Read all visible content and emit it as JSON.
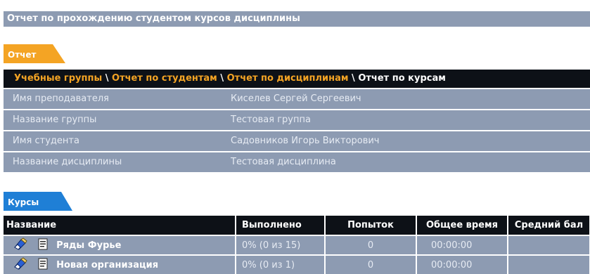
{
  "header": {
    "title": "Отчет по прохождению студентом курсов дисциплины"
  },
  "report_tab": {
    "label": "Отчет"
  },
  "nav": {
    "groups": "Учебные группы",
    "students": "Отчет по студентам",
    "disciplines": "Отчет по дисциплинам",
    "courses": "Отчет по курсам",
    "separator": "\\"
  },
  "info": [
    {
      "label": "Имя преподавателя",
      "value": "Киселев Сергей Сергеевич"
    },
    {
      "label": "Название группы",
      "value": "Тестовая группа"
    },
    {
      "label": "Имя студента",
      "value": "Садовников Игорь Викторович"
    },
    {
      "label": "Название дисциплины",
      "value": "Тестовая дисциплина"
    }
  ],
  "courses_tab": {
    "label": "Курсы"
  },
  "table": {
    "headers": {
      "name": "Название",
      "done": "Выполнено",
      "attempts": "Попыток",
      "time": "Общее время",
      "avg": "Средний бал"
    },
    "rows": [
      {
        "name": "Ряды Фурье",
        "done": "0% (0 из 15)",
        "attempts": "0",
        "time": "00:00:00",
        "avg": ""
      },
      {
        "name": "Новая организация",
        "done": "0% (0 из 1)",
        "attempts": "0",
        "time": "00:00:00",
        "avg": ""
      }
    ]
  },
  "colors": {
    "accent_orange": "#f4a424",
    "accent_blue": "#1f7fd6",
    "row_bg": "#8d9bb2",
    "dark_bar": "#0d1117"
  },
  "icons": {
    "edit": "eraser-pencil-icon",
    "doc": "document-icon"
  }
}
